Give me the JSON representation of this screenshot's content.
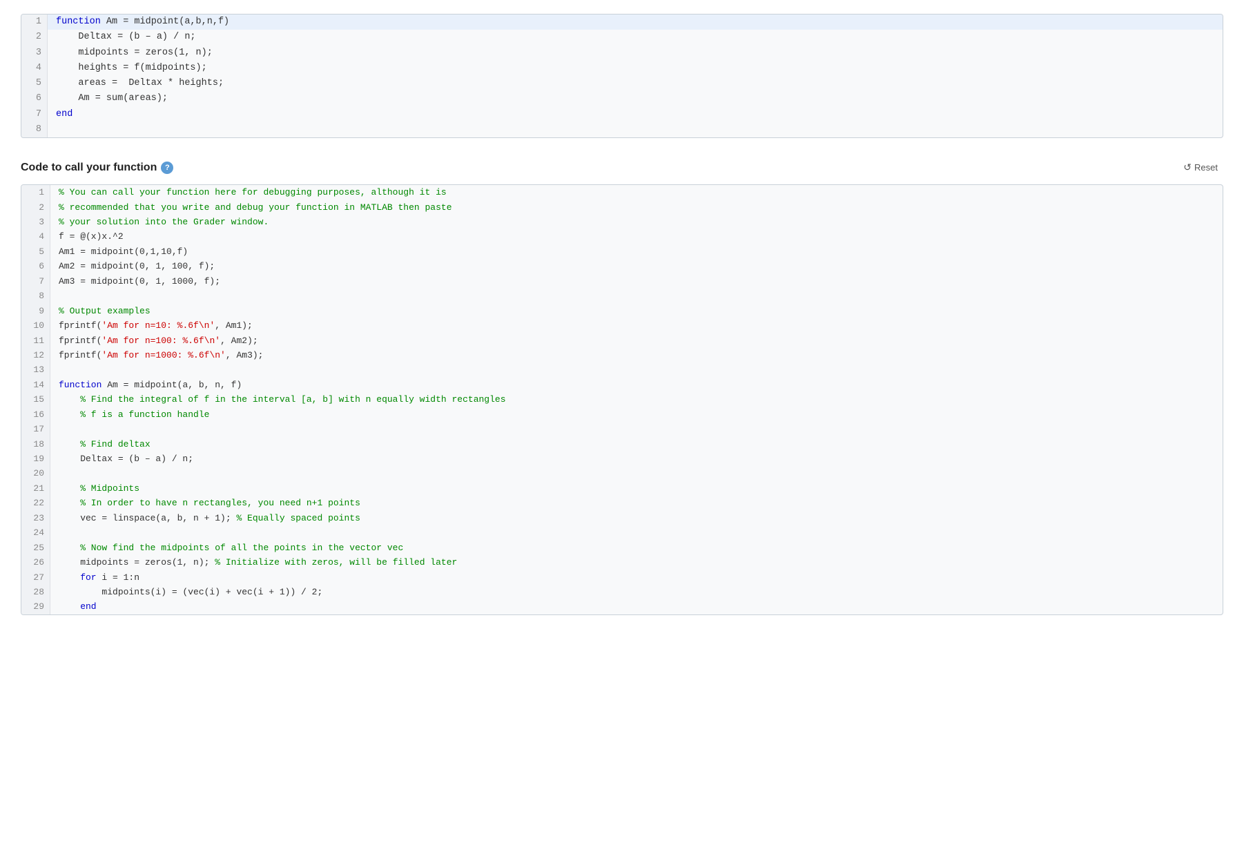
{
  "top_editor": {
    "lines": [
      {
        "num": 1,
        "tokens": [
          {
            "type": "kw-blue",
            "text": "function"
          },
          {
            "type": "plain",
            "text": " Am = midpoint(a,b,n,f)"
          }
        ]
      },
      {
        "num": 2,
        "tokens": [
          {
            "type": "plain",
            "text": "    Deltax = (b – a) / n;"
          }
        ]
      },
      {
        "num": 3,
        "tokens": [
          {
            "type": "plain",
            "text": "    midpoints = zeros(1, n);"
          }
        ]
      },
      {
        "num": 4,
        "tokens": [
          {
            "type": "plain",
            "text": "    heights = f(midpoints);"
          }
        ]
      },
      {
        "num": 5,
        "tokens": [
          {
            "type": "plain",
            "text": "    areas =  Deltax * heights;"
          }
        ]
      },
      {
        "num": 6,
        "tokens": [
          {
            "type": "plain",
            "text": "    Am = sum(areas);"
          }
        ]
      },
      {
        "num": 7,
        "tokens": [
          {
            "type": "kw-end",
            "text": "end"
          }
        ]
      },
      {
        "num": 8,
        "tokens": [
          {
            "type": "plain",
            "text": ""
          }
        ]
      }
    ]
  },
  "section": {
    "title": "Code to call your function",
    "help_label": "?",
    "reset_label": "Reset"
  },
  "bottom_editor": {
    "lines": [
      {
        "num": 1,
        "tokens": [
          {
            "type": "comment",
            "text": "% You can call your function here for debugging purposes, although it is"
          }
        ]
      },
      {
        "num": 2,
        "tokens": [
          {
            "type": "comment",
            "text": "% recommended that you write and debug your function in MATLAB then paste"
          }
        ]
      },
      {
        "num": 3,
        "tokens": [
          {
            "type": "comment",
            "text": "% your solution into the Grader window."
          }
        ]
      },
      {
        "num": 4,
        "tokens": [
          {
            "type": "plain",
            "text": "f = @(x)x.^2"
          }
        ]
      },
      {
        "num": 5,
        "tokens": [
          {
            "type": "plain",
            "text": "Am1 = midpoint(0,1,10,f)"
          }
        ]
      },
      {
        "num": 6,
        "tokens": [
          {
            "type": "plain",
            "text": "Am2 = midpoint(0, 1, 100, f);"
          }
        ]
      },
      {
        "num": 7,
        "tokens": [
          {
            "type": "plain",
            "text": "Am3 = midpoint(0, 1, 1000, f);"
          }
        ]
      },
      {
        "num": 8,
        "tokens": [
          {
            "type": "plain",
            "text": ""
          }
        ]
      },
      {
        "num": 9,
        "tokens": [
          {
            "type": "comment",
            "text": "% Output examples"
          }
        ]
      },
      {
        "num": 10,
        "tokens": [
          {
            "type": "plain",
            "text": "fprintf("
          },
          {
            "type": "string",
            "text": "'Am for n=10: %.6f\\n'"
          },
          {
            "type": "plain",
            "text": ", Am1);"
          }
        ]
      },
      {
        "num": 11,
        "tokens": [
          {
            "type": "plain",
            "text": "fprintf("
          },
          {
            "type": "string",
            "text": "'Am for n=100: %.6f\\n'"
          },
          {
            "type": "plain",
            "text": ", Am2);"
          }
        ]
      },
      {
        "num": 12,
        "tokens": [
          {
            "type": "plain",
            "text": "fprintf("
          },
          {
            "type": "string",
            "text": "'Am for n=1000: %.6f\\n'"
          },
          {
            "type": "plain",
            "text": ", Am3);"
          }
        ]
      },
      {
        "num": 13,
        "tokens": [
          {
            "type": "plain",
            "text": ""
          }
        ]
      },
      {
        "num": 14,
        "tokens": [
          {
            "type": "kw-blue",
            "text": "function"
          },
          {
            "type": "plain",
            "text": " Am = midpoint(a, b, n, f)"
          }
        ]
      },
      {
        "num": 15,
        "tokens": [
          {
            "type": "comment",
            "text": "    % Find the integral of f in the interval [a, b] with n equally width rectangles"
          }
        ]
      },
      {
        "num": 16,
        "tokens": [
          {
            "type": "comment",
            "text": "    % f is a function handle"
          }
        ]
      },
      {
        "num": 17,
        "tokens": [
          {
            "type": "plain",
            "text": ""
          }
        ]
      },
      {
        "num": 18,
        "tokens": [
          {
            "type": "comment",
            "text": "    % Find deltax"
          }
        ]
      },
      {
        "num": 19,
        "tokens": [
          {
            "type": "plain",
            "text": "    Deltax = (b – a) / n;"
          }
        ]
      },
      {
        "num": 20,
        "tokens": [
          {
            "type": "plain",
            "text": ""
          }
        ]
      },
      {
        "num": 21,
        "tokens": [
          {
            "type": "comment",
            "text": "    % Midpoints"
          }
        ]
      },
      {
        "num": 22,
        "tokens": [
          {
            "type": "comment",
            "text": "    % In order to have n rectangles, you need n+1 points"
          }
        ]
      },
      {
        "num": 23,
        "tokens": [
          {
            "type": "plain",
            "text": "    vec = linspace(a, b, n + 1); "
          },
          {
            "type": "comment",
            "text": "% Equally spaced points"
          }
        ]
      },
      {
        "num": 24,
        "tokens": [
          {
            "type": "plain",
            "text": ""
          }
        ]
      },
      {
        "num": 25,
        "tokens": [
          {
            "type": "comment",
            "text": "    % Now find the midpoints of all the points in the vector vec"
          }
        ]
      },
      {
        "num": 26,
        "tokens": [
          {
            "type": "plain",
            "text": "    midpoints = zeros(1, n); "
          },
          {
            "type": "comment",
            "text": "% Initialize with zeros, will be filled later"
          }
        ]
      },
      {
        "num": 27,
        "tokens": [
          {
            "type": "kw-blue",
            "text": "    for"
          },
          {
            "type": "plain",
            "text": " i = 1:n"
          }
        ]
      },
      {
        "num": 28,
        "tokens": [
          {
            "type": "plain",
            "text": "        midpoints(i) = (vec(i) + vec(i + 1)) / 2;"
          }
        ]
      },
      {
        "num": 29,
        "tokens": [
          {
            "type": "kw-end",
            "text": "    end"
          }
        ]
      }
    ]
  }
}
